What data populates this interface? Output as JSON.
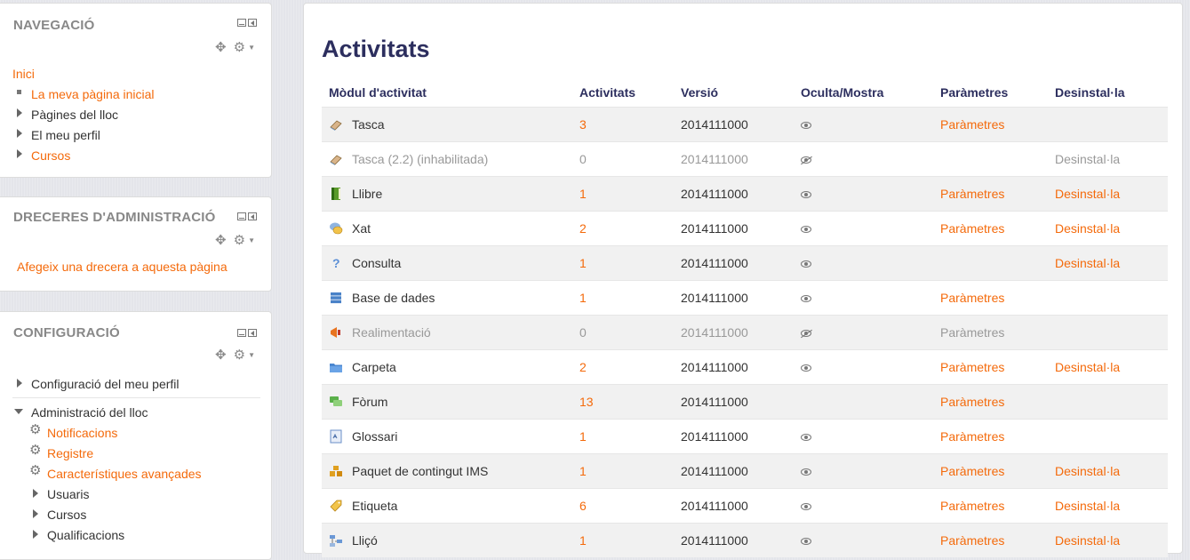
{
  "navigation": {
    "title": "NAVEGACIÓ",
    "home": "Inici",
    "items": [
      "La meva pàgina inicial",
      "Pàgines del lloc",
      "El meu perfil",
      "Cursos"
    ]
  },
  "shortcuts": {
    "title": "DRECERES D'ADMINISTRACIÓ",
    "add_link": "Afegeix una drecera a aquesta pàgina"
  },
  "settings": {
    "title": "CONFIGURACIÓ",
    "profile": "Configuració del meu perfil",
    "site_admin": "Administració del lloc",
    "admin_items": [
      "Notificacions",
      "Registre",
      "Característiques avançades",
      "Usuaris",
      "Cursos",
      "Qualificacions"
    ]
  },
  "main": {
    "title": "Activitats",
    "columns": [
      "Mòdul d'activitat",
      "Activitats",
      "Versió",
      "Oculta/Mostra",
      "Paràmetres",
      "Desinstal·la"
    ],
    "rows": [
      {
        "name": "Tasca",
        "icon": "assignment-icon",
        "count": "3",
        "version": "2014111000",
        "visibility": "shown",
        "settings": "Paràmetres",
        "uninstall": "",
        "disabled": false
      },
      {
        "name": "Tasca (2.2) (inhabilitada)",
        "icon": "assignment-icon",
        "count": "0",
        "version": "2014111000",
        "visibility": "hidden",
        "settings": "",
        "uninstall": "Desinstal·la",
        "disabled": true
      },
      {
        "name": "Llibre",
        "icon": "book-icon",
        "count": "1",
        "version": "2014111000",
        "visibility": "shown",
        "settings": "Paràmetres",
        "uninstall": "Desinstal·la",
        "disabled": false
      },
      {
        "name": "Xat",
        "icon": "chat-icon",
        "count": "2",
        "version": "2014111000",
        "visibility": "shown",
        "settings": "Paràmetres",
        "uninstall": "Desinstal·la",
        "disabled": false
      },
      {
        "name": "Consulta",
        "icon": "choice-icon",
        "count": "1",
        "version": "2014111000",
        "visibility": "shown",
        "settings": "",
        "uninstall": "Desinstal·la",
        "disabled": false
      },
      {
        "name": "Base de dades",
        "icon": "database-icon",
        "count": "1",
        "version": "2014111000",
        "visibility": "shown",
        "settings": "Paràmetres",
        "uninstall": "",
        "disabled": false
      },
      {
        "name": "Realimentació",
        "icon": "feedback-icon",
        "count": "0",
        "version": "2014111000",
        "visibility": "hidden",
        "settings": "Paràmetres",
        "uninstall": "",
        "disabled": true
      },
      {
        "name": "Carpeta",
        "icon": "folder-icon",
        "count": "2",
        "version": "2014111000",
        "visibility": "shown",
        "settings": "Paràmetres",
        "uninstall": "Desinstal·la",
        "disabled": false
      },
      {
        "name": "Fòrum",
        "icon": "forum-icon",
        "count": "13",
        "version": "2014111000",
        "visibility": "none",
        "settings": "Paràmetres",
        "uninstall": "",
        "disabled": false
      },
      {
        "name": "Glossari",
        "icon": "glossary-icon",
        "count": "1",
        "version": "2014111000",
        "visibility": "shown",
        "settings": "Paràmetres",
        "uninstall": "",
        "disabled": false
      },
      {
        "name": "Paquet de contingut IMS",
        "icon": "ims-package-icon",
        "count": "1",
        "version": "2014111000",
        "visibility": "shown",
        "settings": "Paràmetres",
        "uninstall": "Desinstal·la",
        "disabled": false
      },
      {
        "name": "Etiqueta",
        "icon": "label-icon",
        "count": "6",
        "version": "2014111000",
        "visibility": "shown",
        "settings": "Paràmetres",
        "uninstall": "Desinstal·la",
        "disabled": false
      },
      {
        "name": "Lliçó",
        "icon": "lesson-icon",
        "count": "1",
        "version": "2014111000",
        "visibility": "shown",
        "settings": "Paràmetres",
        "uninstall": "Desinstal·la",
        "disabled": false
      }
    ]
  },
  "colors": {
    "link": "#f46a0b",
    "heading": "#2c2e5e",
    "block_title": "#888888"
  }
}
